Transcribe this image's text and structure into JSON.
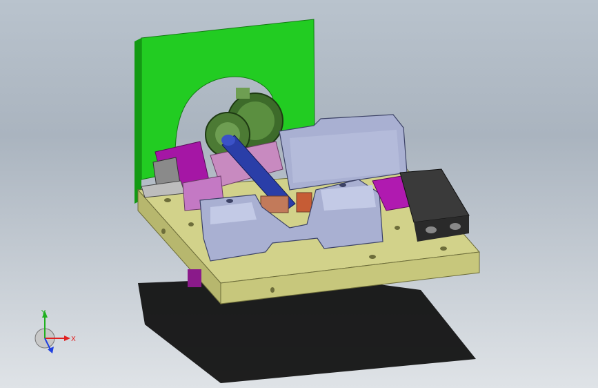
{
  "triad": {
    "x_label": "X",
    "y_label": "Y",
    "x_color": "#e02020",
    "y_color": "#20b020",
    "z_color": "#2040e0"
  },
  "colors": {
    "base_plate": "#cfcf85",
    "green_plate": "#22cc22",
    "clamp_body": "#a9b0d2",
    "gear": "#4c7a34",
    "shaft": "#2a3ea8",
    "magenta_block": "#b01ab0",
    "dark_block": "#3a3a3a",
    "copper": "#c27a5a",
    "background_top": "#b9c3cd",
    "background_bottom": "#dfe3e7"
  }
}
